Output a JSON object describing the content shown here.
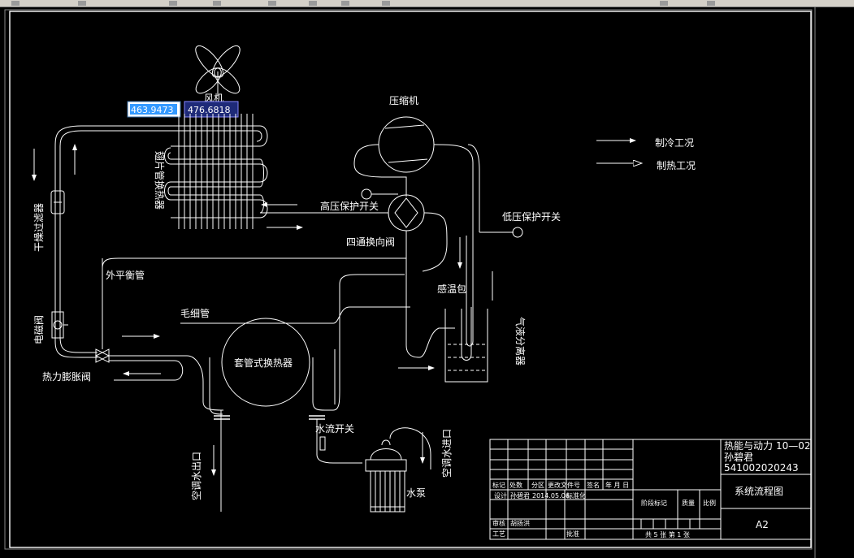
{
  "coord_inputs": {
    "x": "463.9473",
    "y": "476.6818"
  },
  "labels": {
    "fan": "风机",
    "compressor": "压缩机",
    "finned_hx": "翅片管换热器",
    "dryer_filter": "干燥过滤器",
    "solenoid_valve": "电磁阀",
    "thermal_expansion_valve": "热力膨胀阀",
    "external_balance_pipe": "外平衡管",
    "capillary": "毛细管",
    "high_pressure_switch": "高压保护开关",
    "four_way_valve": "四通换向阀",
    "low_pressure_switch": "低压保护开关",
    "sensing_bulb": "感温包",
    "gas_liquid_separator": "气液分离器",
    "tube_hx": "套管式换热器",
    "water_flow_switch": "水流开关",
    "ac_water_outlet": "空调水出口",
    "ac_water_inlet": "空调水进口",
    "water_pump": "水泵"
  },
  "legend": {
    "cooling": "制冷工况",
    "heating": "制热工况"
  },
  "title_block": {
    "school": "热能与动力",
    "class": "10—02",
    "student": "孙碧君",
    "student_id": "541002020243",
    "drawing_title": "系统流程图",
    "sheet_size": "A2",
    "revision_headers": [
      "标记",
      "处数",
      "分区",
      "更改文件号",
      "签名",
      "年 月 日"
    ],
    "designer_label": "设计",
    "designer_name": "孙碧君",
    "date": "2014.05.06",
    "standardize_label": "标准化",
    "stage_mark": "阶段标记",
    "weight": "质量",
    "scale": "比例",
    "review_label": "审核",
    "reviewer_name": "胡扬洪",
    "process_label": "工艺",
    "approve_label": "批准",
    "sheets_info": "共 5 张    第 1 张"
  }
}
